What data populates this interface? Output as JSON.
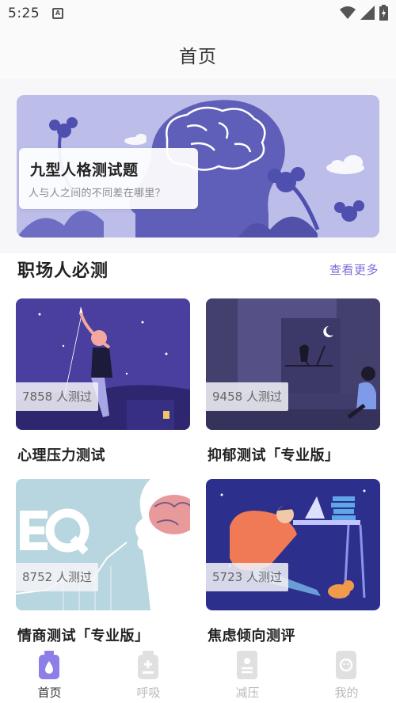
{
  "status_bar": {
    "time": "5:25",
    "notification_glyph": "A"
  },
  "header": {
    "title": "首页"
  },
  "banner": {
    "title": "九型人格测试题",
    "subtitle": "人与人之间的不同差在哪里？"
  },
  "section": {
    "title": "职场人必测",
    "more": "查看更多"
  },
  "tests": [
    {
      "name": "心理压力测试",
      "count": "7858 人测过",
      "color": "#4a3f9e"
    },
    {
      "name": "抑郁测试「专业版」",
      "count": "9458 人测过",
      "color": "#555086"
    },
    {
      "name": "情商测试「专业版」",
      "count": "8752 人测过",
      "color": "#b8d6df"
    },
    {
      "name": "焦虑倾向测评",
      "count": "5723 人测过",
      "color": "#2d2f8c"
    }
  ],
  "bottom_nav": [
    {
      "label": "首页",
      "icon": "home-bottle-icon",
      "active": true
    },
    {
      "label": "呼吸",
      "icon": "breath-jar-icon",
      "active": false
    },
    {
      "label": "减压",
      "icon": "relax-book-icon",
      "active": false
    },
    {
      "label": "我的",
      "icon": "profile-face-icon",
      "active": false
    }
  ],
  "colors": {
    "accent": "#7b6fd6",
    "banner_bg": "#bcbde9"
  }
}
